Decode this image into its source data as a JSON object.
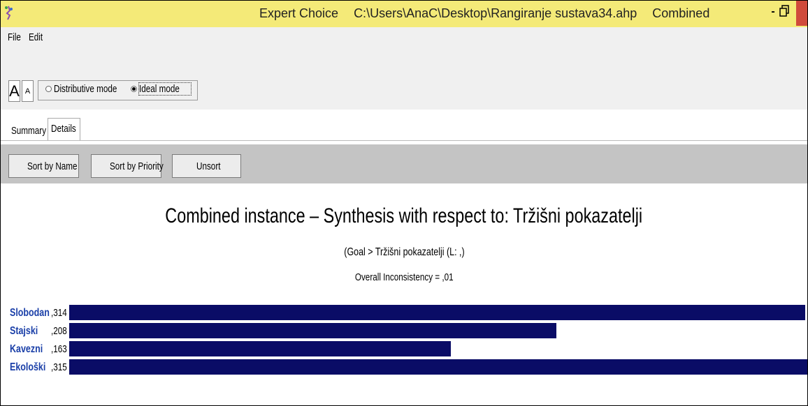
{
  "window": {
    "app_name": "Expert Choice",
    "file_path": "C:\\Users\\AnaC\\Desktop\\Rangiranje sustava34.ahp",
    "view": "Combined",
    "minimize_label": "-",
    "title_color": "#f4ea78"
  },
  "menu": {
    "file": "File",
    "edit": "Edit"
  },
  "toolbar": {
    "font_increase": "A",
    "font_decrease": "A",
    "mode_distributive": "Distributive mode",
    "mode_ideal": "Ideal mode",
    "selected_mode": "Ideal mode"
  },
  "tabs": {
    "summary": "Summary",
    "details": "Details",
    "active": "Summary"
  },
  "buttons": {
    "sort_name": "Sort by Name",
    "sort_priority": "Sort by Priority",
    "unsort": "Unsort"
  },
  "synthesis": {
    "title": "Combined instance – Synthesis with respect to: Tržišni pokazatelji",
    "subtitle": "(Goal > Tržišni pokazatelji (L: ,)",
    "inconsistency": "Overall Inconsistency = ,01",
    "bar_color": "#0a0c66",
    "label_color": "#1a3fa8"
  },
  "chart_data": {
    "type": "bar",
    "categories": [
      "Slobodan",
      "Stajski",
      "Kavezni",
      "Ekološki"
    ],
    "values": [
      0.314,
      0.208,
      0.163,
      0.315
    ],
    "value_labels": [
      ",314",
      ",208",
      ",163",
      ",315"
    ],
    "title": "Combined instance – Synthesis with respect to: Tržišni pokazatelji",
    "xlim": [
      0,
      0.315
    ]
  }
}
